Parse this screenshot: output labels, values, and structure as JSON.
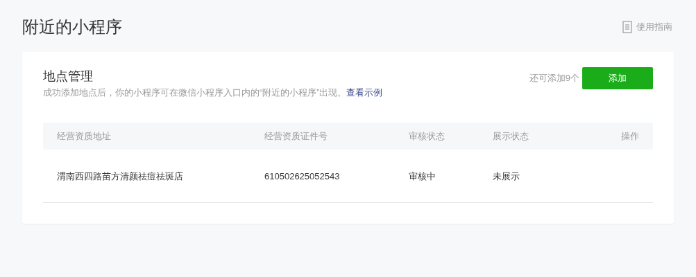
{
  "page": {
    "title": "附近的小程序",
    "guide_link": "使用指南"
  },
  "card": {
    "title": "地点管理",
    "description": "成功添加地点后，你的小程序可在微信小程序入口内的“附近的小程序”出现。",
    "example_link": "查看示例",
    "remaining": "还可添加9个",
    "add_button": "添加"
  },
  "table": {
    "columns": [
      "经营资质地址",
      "经营资质证件号",
      "审核状态",
      "展示状态",
      "操作"
    ],
    "rows": [
      [
        "渭南西四路苗方清颜祛痘祛斑店",
        "610502625052543",
        "审核中",
        "未展示",
        ""
      ]
    ]
  }
}
